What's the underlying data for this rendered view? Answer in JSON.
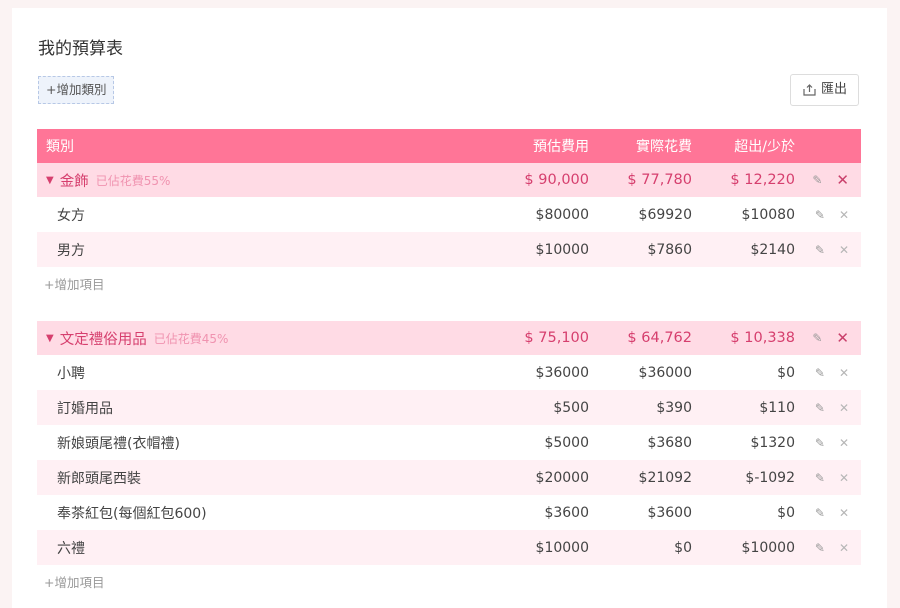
{
  "page": {
    "title": "我的預算表",
    "add_category_label": "+增加類別",
    "export_label": "匯出"
  },
  "table_header": {
    "name": "類別",
    "estimated": "預估費用",
    "actual": "實際花費",
    "diff": "超出/少於"
  },
  "categories": [
    {
      "name": "金飾",
      "percent_label": "已佔花費55%",
      "estimated": "$ 90,000",
      "actual": "$ 77,780",
      "diff": "$ 12,220",
      "items": [
        {
          "name": "女方",
          "estimated": "$80000",
          "actual": "$69920",
          "diff": "$10080"
        },
        {
          "name": "男方",
          "estimated": "$10000",
          "actual": "$7860",
          "diff": "$2140"
        }
      ],
      "add_item_label": "+增加項目"
    },
    {
      "name": "文定禮俗用品",
      "percent_label": "已佔花費45%",
      "estimated": "$ 75,100",
      "actual": "$ 64,762",
      "diff": "$ 10,338",
      "items": [
        {
          "name": "小聘",
          "estimated": "$36000",
          "actual": "$36000",
          "diff": "$0"
        },
        {
          "name": "訂婚用品",
          "estimated": "$500",
          "actual": "$390",
          "diff": "$110"
        },
        {
          "name": "新娘頭尾禮(衣帽禮)",
          "estimated": "$5000",
          "actual": "$3680",
          "diff": "$1320"
        },
        {
          "name": "新郎頭尾西裝",
          "estimated": "$20000",
          "actual": "$21092",
          "diff": "$-1092"
        },
        {
          "name": "奉茶紅包(每個紅包600)",
          "estimated": "$3600",
          "actual": "$3600",
          "diff": "$0"
        },
        {
          "name": "六禮",
          "estimated": "$10000",
          "actual": "$0",
          "diff": "$10000"
        }
      ],
      "add_item_label": "+增加項目"
    }
  ],
  "colors": {
    "header_bg": "#ff7597",
    "category_bg": "#ffdbe5",
    "category_text": "#d63f6e",
    "alt_row_bg": "#fff0f4"
  },
  "icons": {
    "export": "export-icon",
    "edit": "pencil-icon",
    "delete": "close-icon",
    "collapse": "caret-down-icon"
  }
}
